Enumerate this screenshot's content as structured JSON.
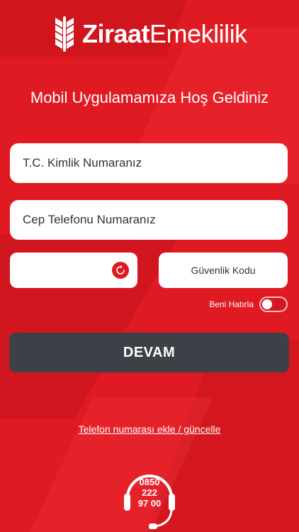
{
  "brand": {
    "name_bold": "Ziraat",
    "name_regular": "Emeklilik"
  },
  "welcome_text": "Mobil Uygulamamıza Hoş Geldiniz",
  "form": {
    "tc_placeholder": "T.C. Kimlik Numaranız",
    "phone_placeholder": "Cep Telefonu Numaranız",
    "captcha_value": "",
    "security_code_placeholder": "Güvenlik Kodu",
    "remember_label": "Beni Hatırla",
    "remember_on": false,
    "submit_label": "DEVAM"
  },
  "phone_link": "Telefon numarası ekle / güncelle",
  "support": {
    "line1": "0850",
    "line2": "222",
    "line3": "97 00",
    "icon": "headset-icon"
  },
  "colors": {
    "primary": "#e01a22",
    "button": "#3d4147",
    "field": "#ffffff"
  }
}
